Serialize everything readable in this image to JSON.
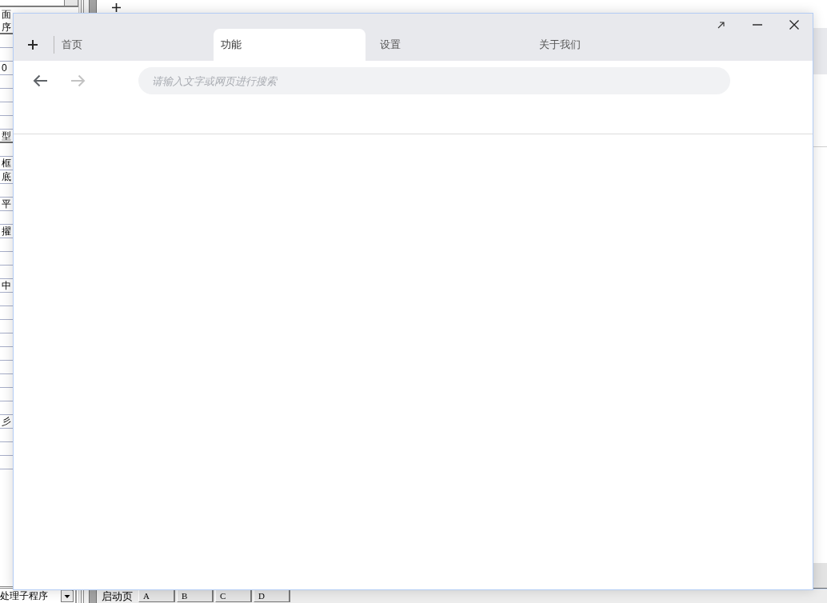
{
  "ide": {
    "property_list": {
      "rows": [
        {
          "text": "面"
        },
        {
          "text": "序"
        },
        {
          "text": "0"
        },
        {
          "text": "型"
        },
        {
          "text": "框"
        },
        {
          "text": "底"
        },
        {
          "text": "平"
        },
        {
          "text": "擢"
        },
        {
          "text": "中"
        },
        {
          "text": "彡"
        }
      ]
    },
    "bottom_bar": {
      "select": {
        "value": "处理子程序"
      },
      "tabs": [
        {
          "label": "启动页",
          "selected": true
        },
        {
          "label": "A",
          "selected": false
        },
        {
          "label": "B",
          "selected": false
        },
        {
          "label": "C",
          "selected": false
        },
        {
          "label": "D",
          "selected": false
        }
      ]
    }
  },
  "window": {
    "tabs": [
      {
        "label": "首页",
        "selected": false
      },
      {
        "label": "功能",
        "selected": true
      },
      {
        "label": "设置",
        "selected": false
      },
      {
        "label": "关于我们",
        "selected": false
      }
    ],
    "navigation": {
      "back": {
        "disabled": false
      },
      "forward": {
        "disabled": true
      }
    },
    "search": {
      "placeholder": "请输入文字或网页进行搜索"
    }
  }
}
